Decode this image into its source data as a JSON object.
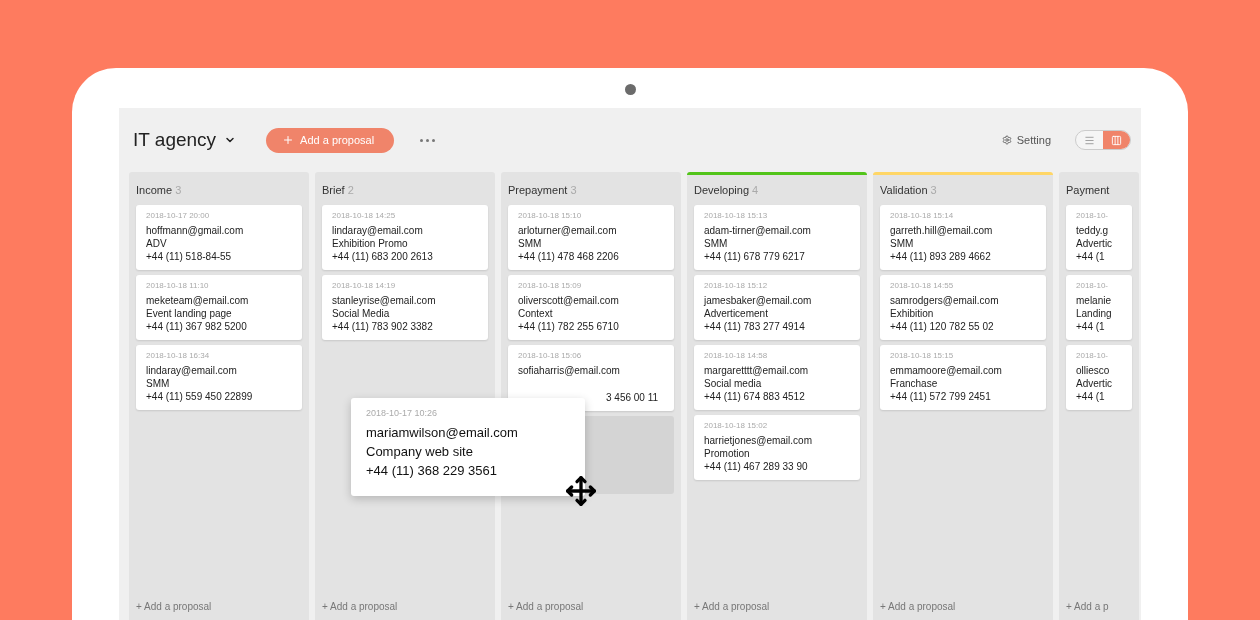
{
  "board": {
    "title": "IT agency",
    "add_button": "Add a proposal",
    "setting": "Setting",
    "views": [
      {
        "kind": "list",
        "selected": false
      },
      {
        "kind": "board",
        "selected": true
      }
    ]
  },
  "columns": [
    {
      "name": "Income",
      "count": "3",
      "add_label": "+ Add a proposal",
      "cards": [
        {
          "date": "2018-10-17 20:00",
          "email": "hoffmann@gmail.com",
          "subject": "ADV",
          "phone": "+44 (11) 518-84-55"
        },
        {
          "date": "2018-10-18 11:10",
          "email": "meketeam@email.com",
          "subject": "Event landing page",
          "phone": "+44 (11) 367 982 5200"
        },
        {
          "date": "2018-10-18 16:34",
          "email": "lindaray@email.com",
          "subject": "SMM",
          "phone": "+44 (11) 559 450 22899"
        }
      ]
    },
    {
      "name": "Brief",
      "count": "2",
      "add_label": "+ Add a proposal",
      "cards": [
        {
          "date": "2018-10-18 14:25",
          "email": "lindaray@email.com",
          "subject": "Exhibition Promo",
          "phone": "+44 (11) 683 200 2613"
        },
        {
          "date": "2018-10-18 14:19",
          "email": "stanleyrise@email.com",
          "subject": "Social Media",
          "phone": "+44 (11) 783 902 3382"
        }
      ]
    },
    {
      "name": "Prepayment",
      "count": "3",
      "add_label": "+ Add a proposal",
      "drop_slot": true,
      "cards": [
        {
          "date": "2018-10-18 15:10",
          "email": "arloturner@email.com",
          "subject": "SMM",
          "phone": "+44 (11) 478 468 2206"
        },
        {
          "date": "2018-10-18 15:09",
          "email": "oliverscott@email.com",
          "subject": "Context",
          "phone": "+44 (11) 782 255 6710"
        },
        {
          "date": "2018-10-18 15:06",
          "email": "sofiaharris@email.com",
          "phone": "3 456 00 11",
          "covered": true
        }
      ]
    },
    {
      "name": "Developing",
      "count": "4",
      "color": "#52c41a",
      "add_label": "+ Add a proposal",
      "cards": [
        {
          "date": "2018-10-18 15:13",
          "email": "adam-tirner@email.com",
          "subject": "SMM",
          "phone": "+44 (11) 678 779 6217"
        },
        {
          "date": "2018-10-18 15:12",
          "email": "jamesbaker@email.com",
          "subject": "Adverticement",
          "phone": "+44 (11) 783 277 4914"
        },
        {
          "date": "2018-10-18 14:58",
          "email": "margaretttt@email.com",
          "subject": "Social media",
          "phone": "+44 (11) 674 883 4512"
        },
        {
          "date": "2018-10-18 15:02",
          "email": "harrietjones@email.com",
          "subject": "Promotion",
          "phone": "+44 (11) 467 289 33 90"
        }
      ]
    },
    {
      "name": "Validation",
      "count": "3",
      "color": "#ffd666",
      "add_label": "+ Add a proposal",
      "cards": [
        {
          "date": "2018-10-18 15:14",
          "email": "garreth.hill@email.com",
          "subject": "SMM",
          "phone": "+44 (11) 893 289 4662"
        },
        {
          "date": "2018-10-18 14:55",
          "email": "samrodgers@email.com",
          "subject": "Exhibition",
          "phone": "+44 (11) 120 782 55 02"
        },
        {
          "date": "2018-10-18 15:15",
          "email": "emmamoore@email.com",
          "subject": "Franchase",
          "phone": "+44 (11) 572 799 2451"
        }
      ]
    },
    {
      "name": "Payment",
      "add_label": "+ Add a p",
      "cards": [
        {
          "date": "2018-10-",
          "email": "teddy.g",
          "subject": "Advertic",
          "phone": "+44 (1"
        },
        {
          "date": "2018-10-",
          "email": "melanie",
          "subject": "Landing",
          "phone": "+44 (1"
        },
        {
          "date": "2018-10-",
          "email": "olliesco",
          "subject": "Advertic",
          "phone": "+44 (1"
        }
      ]
    }
  ],
  "dragged_card": {
    "date": "2018-10-17 10:26",
    "email": "mariamwilson@email.com",
    "subject": "Company web site",
    "phone": "+44 (11) 368 229 3561"
  }
}
